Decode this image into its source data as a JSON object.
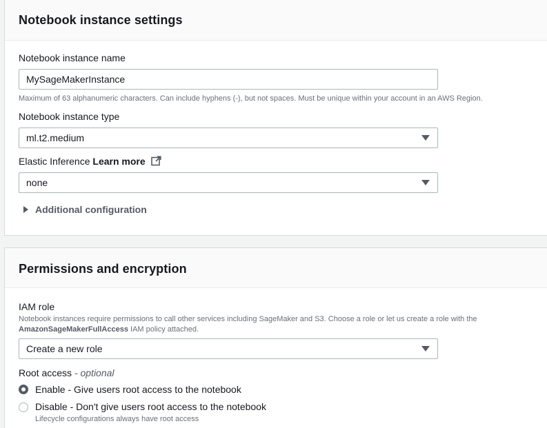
{
  "settings": {
    "title": "Notebook instance settings",
    "name_label": "Notebook instance name",
    "name_value": "MySageMakerInstance",
    "name_help": "Maximum of 63 alphanumeric characters. Can include hyphens (-), but not spaces. Must be unique within your account in an AWS Region.",
    "type_label": "Notebook instance type",
    "type_value": "ml.t2.medium",
    "ei_label": "Elastic Inference",
    "ei_learn_more": "Learn more",
    "ei_value": "none",
    "additional_config": "Additional configuration"
  },
  "permissions": {
    "title": "Permissions and encryption",
    "iam_label": "IAM role",
    "iam_help_prefix": "Notebook instances require permissions to call other services including SageMaker and S3. Choose a role or let us create a role with the",
    "iam_help_policy": "AmazonSageMakerFullAccess",
    "iam_help_suffix": "IAM policy attached.",
    "iam_value": "Create a new role",
    "root_label": "Root access",
    "root_optional": "- optional",
    "root_enable": "Enable - Give users root access to the notebook",
    "root_disable": "Disable - Don't give users root access to the notebook",
    "root_disable_help": "Lifecycle configurations always have root access",
    "root_selected": "enable"
  },
  "icons": {
    "external_link": "external-link-icon",
    "caret": "caret-down-icon",
    "expand": "caret-right-icon"
  },
  "colors": {
    "panel_header_bg": "#fafafa",
    "text": "#16191f",
    "help_text": "#687078",
    "border": "#aab7b8"
  }
}
